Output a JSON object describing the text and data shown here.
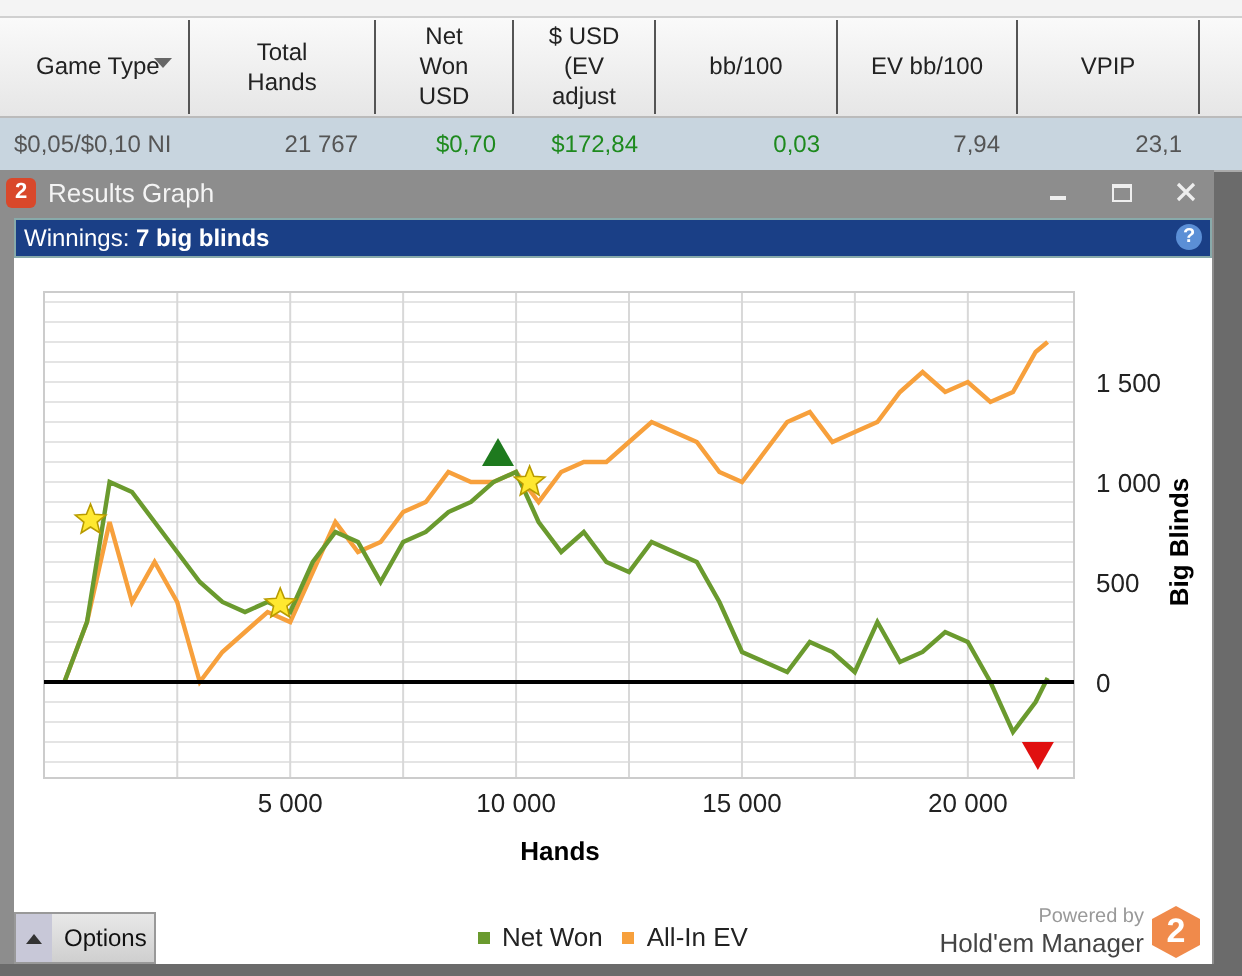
{
  "table": {
    "columns": [
      {
        "label": "Game Type",
        "kind": "dropdown"
      },
      {
        "label": "Total\nHands",
        "kind": "plain"
      },
      {
        "label": "Net\nWon\nUSD",
        "kind": "plain"
      },
      {
        "label": "$ USD\n(EV\nadjust",
        "kind": "plain"
      },
      {
        "label": "bb/100",
        "kind": "plain"
      },
      {
        "label": "EV bb/100",
        "kind": "plain"
      },
      {
        "label": "VPIP",
        "kind": "plain"
      }
    ],
    "rows": [
      {
        "selected": true,
        "cells": [
          {
            "text": "$0,05/$0,10 NI",
            "color": "#555555"
          },
          {
            "text": "21 767",
            "color": "#555555"
          },
          {
            "text": "$0,70",
            "color": "#1e8a1e"
          },
          {
            "text": "$172,84",
            "color": "#1e8a1e"
          },
          {
            "text": "0,03",
            "color": "#1e8a1e"
          },
          {
            "text": "7,94",
            "color": "#555555"
          },
          {
            "text": "23,1",
            "color": "#555555"
          }
        ]
      }
    ]
  },
  "window": {
    "icon_text": "2",
    "title": "Results Graph"
  },
  "infobar": {
    "text": "Winnings: **7 big blinds**",
    "help": "?"
  },
  "chart": {
    "chart_data": {
      "type": "line",
      "xlabel": "Hands",
      "ylabel": "Big Blinds",
      "xlim": [
        -450,
        22350
      ],
      "ylim": [
        -480,
        1950
      ],
      "xticks": [
        {
          "value": 5000,
          "label": "5 000"
        },
        {
          "value": 10000,
          "label": "10 000"
        },
        {
          "value": 15000,
          "label": "15 000"
        },
        {
          "value": 20000,
          "label": "20 000"
        }
      ],
      "yticks": [
        {
          "value": 0,
          "label": "0"
        },
        {
          "value": 500,
          "label": "500"
        },
        {
          "value": 1000,
          "label": "1 000"
        },
        {
          "value": 1500,
          "label": "1 500"
        }
      ],
      "x": [
        0,
        500,
        1000,
        1500,
        2000,
        2500,
        3000,
        3500,
        4000,
        4500,
        5000,
        5500,
        6000,
        6500,
        7000,
        7500,
        8000,
        8500,
        9000,
        9500,
        10000,
        10500,
        11000,
        11500,
        12000,
        12500,
        13000,
        13500,
        14000,
        14500,
        15000,
        15500,
        16000,
        16500,
        17000,
        17500,
        18000,
        18500,
        19000,
        19500,
        20000,
        20500,
        21000,
        21500,
        21767
      ],
      "series": [
        {
          "name": "Net Won",
          "color": "#6a9a2e",
          "values": [
            0,
            300,
            1000,
            950,
            800,
            650,
            500,
            400,
            350,
            400,
            350,
            600,
            750,
            700,
            500,
            700,
            750,
            850,
            900,
            1000,
            1050,
            800,
            650,
            750,
            600,
            550,
            700,
            650,
            600,
            400,
            150,
            100,
            50,
            200,
            150,
            50,
            300,
            100,
            150,
            250,
            200,
            0,
            -250,
            -100,
            20
          ]
        },
        {
          "name": "All-In EV",
          "color": "#f7a03c",
          "values": [
            0,
            300,
            800,
            400,
            600,
            400,
            0,
            150,
            250,
            350,
            300,
            550,
            800,
            650,
            700,
            850,
            900,
            1050,
            1000,
            1000,
            1050,
            900,
            1050,
            1100,
            1100,
            1200,
            1300,
            1250,
            1200,
            1050,
            1000,
            1150,
            1300,
            1350,
            1200,
            1250,
            1300,
            1450,
            1550,
            1450,
            1500,
            1400,
            1450,
            1650,
            1700
          ]
        }
      ],
      "grid": true
    },
    "powered_by": "Powered by",
    "brand": "Hold'em Manager",
    "logo_text": "2"
  },
  "footer": {
    "options_button": "Options"
  }
}
